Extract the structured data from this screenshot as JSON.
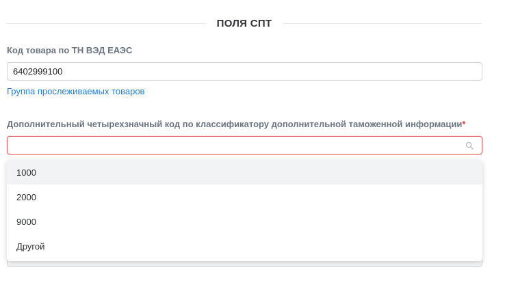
{
  "section": {
    "title": "ПОЛЯ СПТ"
  },
  "tnved": {
    "label": "Код товара по ТН ВЭД ЕАЭС",
    "value": "6402999100",
    "link": "Группа прослеживаемых товаров"
  },
  "additional_code": {
    "label": "Дополнительный четырехзначный код по классификатору дополнительной таможенной информации",
    "required_mark": "*",
    "value": "",
    "icon": "search-icon",
    "options": [
      "1000",
      "2000",
      "9000",
      "Другой"
    ],
    "hovered_option": 0
  },
  "colors": {
    "error_border": "#e35b5b",
    "link": "#1f7fd6",
    "required": "#e53935"
  }
}
